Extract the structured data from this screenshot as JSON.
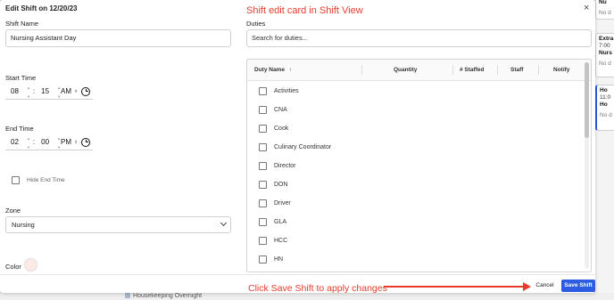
{
  "modal": {
    "title": "Edit Shift on 12/20/23",
    "close_glyph": "×",
    "annotation_top": "Shift edit card in Shift View",
    "annotation_bottom": "Click Save Shift to apply changes",
    "annotation_color": "#e83b2f"
  },
  "shift_name": {
    "label": "Shift Name",
    "value": "Nursing Assistant Day"
  },
  "duties_search": {
    "label": "Duties",
    "placeholder": "Search for duties..."
  },
  "start_time": {
    "label": "Start Time",
    "hour": "08",
    "sep": ":",
    "minute": "15",
    "ampm": "AM"
  },
  "end_time": {
    "label": "End Time",
    "hour": "02",
    "sep": ":",
    "minute": "00",
    "ampm": "PM"
  },
  "hide_end_time": {
    "label": "Hide End Time",
    "checked": false
  },
  "zone": {
    "label": "Zone",
    "value": "Nursing"
  },
  "color": {
    "label": "Color",
    "value": "#fde9e6"
  },
  "duties_table": {
    "columns": [
      "Duty Name",
      "Quantity",
      "# Staffed",
      "Staff",
      "Notify"
    ],
    "sort_glyph": "↑",
    "rows": [
      "Activities",
      "CNA",
      "Cook",
      "Culinary Coordinator",
      "Director",
      "DON",
      "Driver",
      "GLA",
      "HCC",
      "HN"
    ]
  },
  "footer": {
    "cancel_label": "Cancel",
    "save_label": "Save Shift",
    "accent": "#2d5be3"
  },
  "background": {
    "cards": [
      {
        "line1": "Nu",
        "line2": "No d"
      },
      {
        "line1": "Extra",
        "line2": "7:00",
        "line3": "Nurs",
        "line4": "No d"
      },
      {
        "line1": "Ho",
        "line2": "11:0",
        "line3": "Ho",
        "line4": "No d"
      }
    ],
    "bottom_shift": "Housekeeping Overnight"
  }
}
